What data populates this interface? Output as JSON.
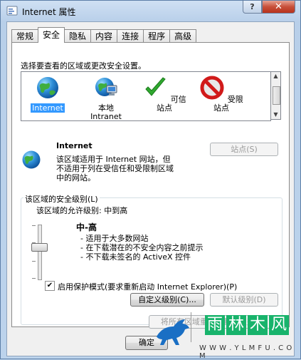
{
  "window": {
    "title": "Internet 属性",
    "help_label": "?",
    "close_label": "✕"
  },
  "tabs": [
    {
      "label": "常规"
    },
    {
      "label": "安全"
    },
    {
      "label": "隐私"
    },
    {
      "label": "内容"
    },
    {
      "label": "连接"
    },
    {
      "label": "程序"
    },
    {
      "label": "高级"
    }
  ],
  "security": {
    "select_zone_prompt": "选择要查看的区域或更改安全设置。",
    "zones": [
      {
        "line1": "Internet",
        "line2": "",
        "icon": "globe-icon",
        "selected": true
      },
      {
        "line1": "本地",
        "line2": "Intranet",
        "icon": "local-intranet-icon",
        "selected": false
      },
      {
        "line1": "可信站点",
        "line2": "",
        "icon": "checkmark-icon",
        "selected": false
      },
      {
        "line1": "受限站点",
        "line2": "",
        "icon": "restricted-icon",
        "selected": false
      }
    ],
    "zone_title": "Internet",
    "zone_desc_1": "该区域适用于 Internet 网站，但",
    "zone_desc_2": "不适用于列在受信任和受限制区域",
    "zone_desc_3": "中的网站。",
    "sites_button": "站点(S)",
    "level_group_label": "该区域的安全级别(L)",
    "allowed_level": "该区域的允许级别: 中到高",
    "level_name": "中-高",
    "level_bullets": [
      "- 适用于大多数网站",
      "- 在下载潜在的不安全内容之前提示",
      "- 不下载未签名的 ActiveX 控件"
    ],
    "protected_mode_label": "启用保护模式(要求重新启动 Internet Explorer)(P)",
    "protected_mode_checked": true,
    "custom_level_button": "自定义级别(C)...",
    "default_level_button": "默认级别(D)",
    "reset_all_button": "将所有区域重置为默认级别(R)"
  },
  "footer": {
    "ok_button": "确定"
  },
  "watermark": {
    "char1": "雨",
    "char2": "林",
    "char3": "木",
    "char4": "风",
    "url": "W W W . Y L M F U . C O M"
  },
  "colors": {
    "selection": "#3399ff",
    "close": "#c7503a",
    "watermark": "#18b36b"
  }
}
